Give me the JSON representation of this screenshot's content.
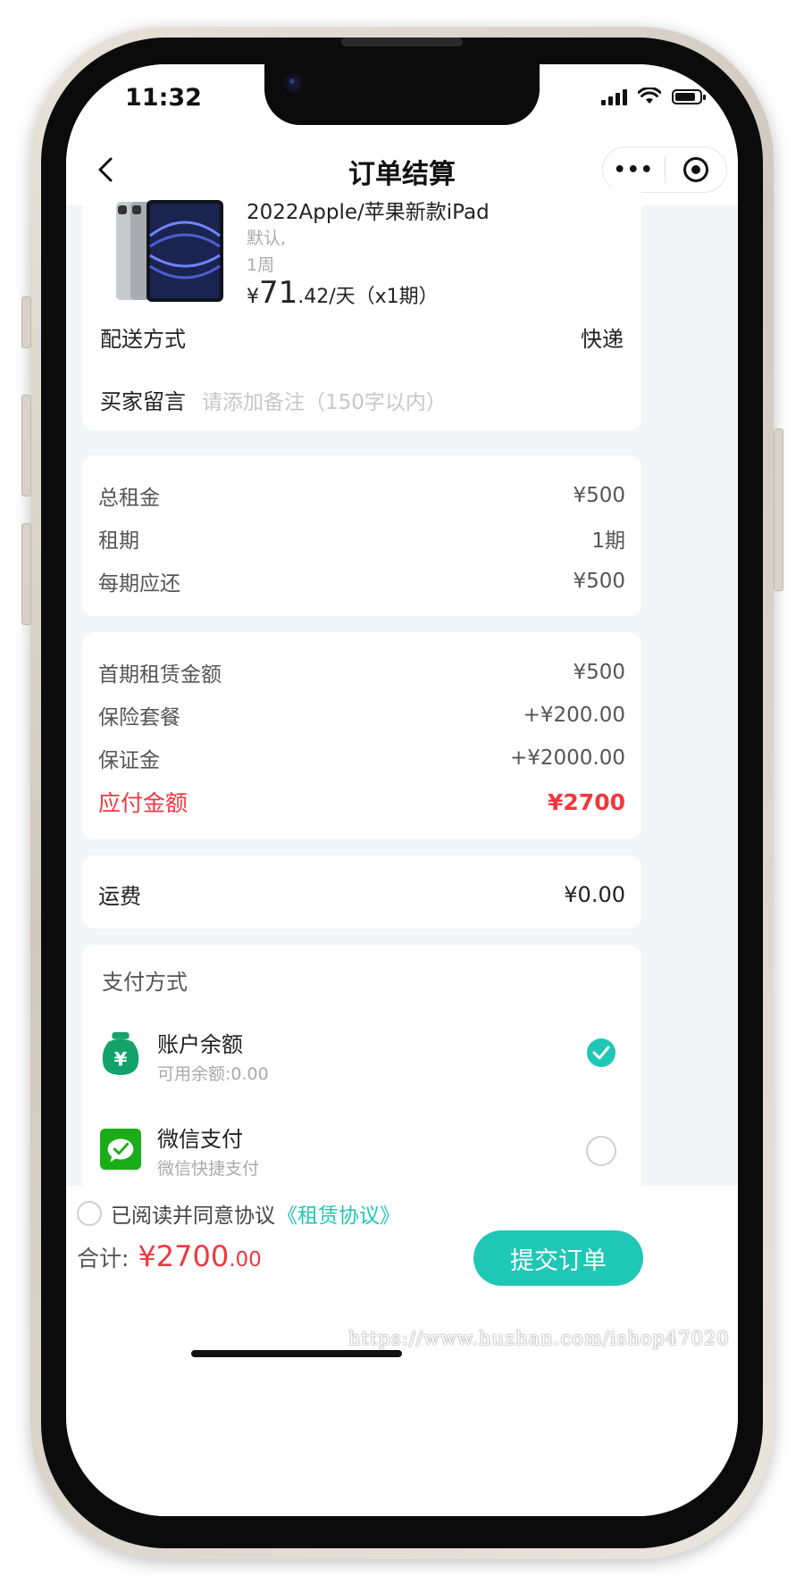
{
  "status_bar": {
    "time": "11:32"
  },
  "nav": {
    "title": "订单结算",
    "more_label": "•••"
  },
  "product": {
    "name": "2022Apple/苹果新款iPad",
    "spec_1": "默认,",
    "spec_2": "1周",
    "price_symbol": "¥",
    "price_int": "71",
    "price_suffix": ".42/天（x1期）"
  },
  "delivery": {
    "label": "配送方式",
    "value": "快递"
  },
  "remark": {
    "label": "买家留言",
    "placeholder": "请添加备注（150字以内）"
  },
  "rent_summary": [
    {
      "label": "总租金",
      "value": "¥500"
    },
    {
      "label": "租期",
      "value": "1期"
    },
    {
      "label": "每期应还",
      "value": "¥500"
    }
  ],
  "payment_summary": [
    {
      "label": "首期租赁金额",
      "value": "¥500"
    },
    {
      "label": "保险套餐",
      "value": "+¥200.00"
    },
    {
      "label": "保证金",
      "value": "+¥2000.00"
    }
  ],
  "payable": {
    "label": "应付金额",
    "value": "¥2700"
  },
  "shipping": {
    "label": "运费",
    "value": "¥0.00"
  },
  "pay_methods": {
    "title": "支付方式",
    "items": [
      {
        "name": "账户余额",
        "desc": "可用余额:0.00",
        "selected": true
      },
      {
        "name": "微信支付",
        "desc": "微信快捷支付",
        "selected": false
      }
    ]
  },
  "agreement": {
    "text": "已阅读并同意协议",
    "link": "《租赁协议》"
  },
  "total": {
    "label": "合计:",
    "amount_main": "¥2700",
    "amount_decimal": ".00"
  },
  "submit_label": "提交订单",
  "watermark": "https://www.huzhan.com/ishop47020",
  "colors": {
    "accent": "#1fc7b6",
    "price_red": "#f0373f",
    "wechat_green": "#1aad19",
    "wallet_green": "#12a26a"
  }
}
